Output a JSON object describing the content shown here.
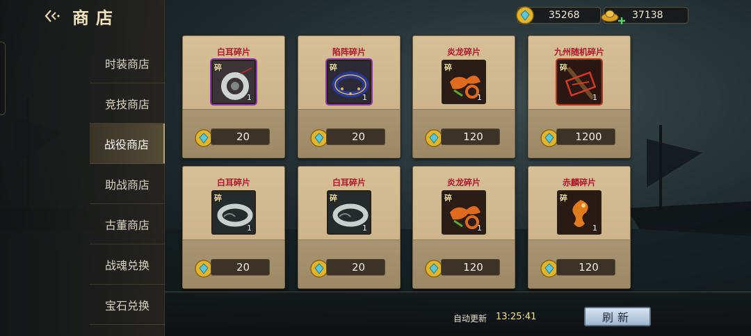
{
  "header": {
    "title": "商店"
  },
  "nav": {
    "items": [
      {
        "label": "时装商店"
      },
      {
        "label": "竞技商店"
      },
      {
        "label": "战役商店",
        "active": true
      },
      {
        "label": "助战商店"
      },
      {
        "label": "古董商店"
      },
      {
        "label": "战魂兑换"
      },
      {
        "label": "宝石兑换"
      }
    ]
  },
  "currency": {
    "gold_coins": "35268",
    "ingots": "37138"
  },
  "shop_items": [
    {
      "name": "白耳碎片",
      "fragment_tag": "碎",
      "count": "1",
      "price": "20",
      "frame": "purple",
      "icon": "silver-bracelet-icon"
    },
    {
      "name": "陷阵碎片",
      "fragment_tag": "碎",
      "count": "1",
      "price": "20",
      "frame": "purple",
      "icon": "blue-ring-icon"
    },
    {
      "name": "炎龙碎片",
      "fragment_tag": "碎",
      "count": "1",
      "price": "120",
      "frame": "none",
      "icon": "fire-dragon-icon"
    },
    {
      "name": "九州随机碎片",
      "fragment_tag": "碎",
      "count": "1",
      "price": "1200",
      "frame": "red",
      "icon": "random-fragment-icon"
    },
    {
      "name": "白耳碎片",
      "fragment_tag": "碎",
      "count": "1",
      "price": "20",
      "frame": "none",
      "icon": "silver-bracelet-icon"
    },
    {
      "name": "白耳碎片",
      "fragment_tag": "碎",
      "count": "1",
      "price": "20",
      "frame": "none",
      "icon": "silver-bracelet-icon"
    },
    {
      "name": "炎龙碎片",
      "fragment_tag": "碎",
      "count": "1",
      "price": "120",
      "frame": "none",
      "icon": "fire-dragon-icon"
    },
    {
      "name": "赤麟碎片",
      "fragment_tag": "碎",
      "count": "1",
      "price": "120",
      "frame": "none",
      "icon": "red-qilin-icon"
    }
  ],
  "footer": {
    "auto_refresh_label": "自动更新",
    "auto_refresh_time": "13:25:41",
    "refresh_button": "刷新"
  },
  "colors": {
    "item_name": "#b0142a",
    "accent_gold": "#f3e68a",
    "card_bg": "#d6bf96"
  }
}
